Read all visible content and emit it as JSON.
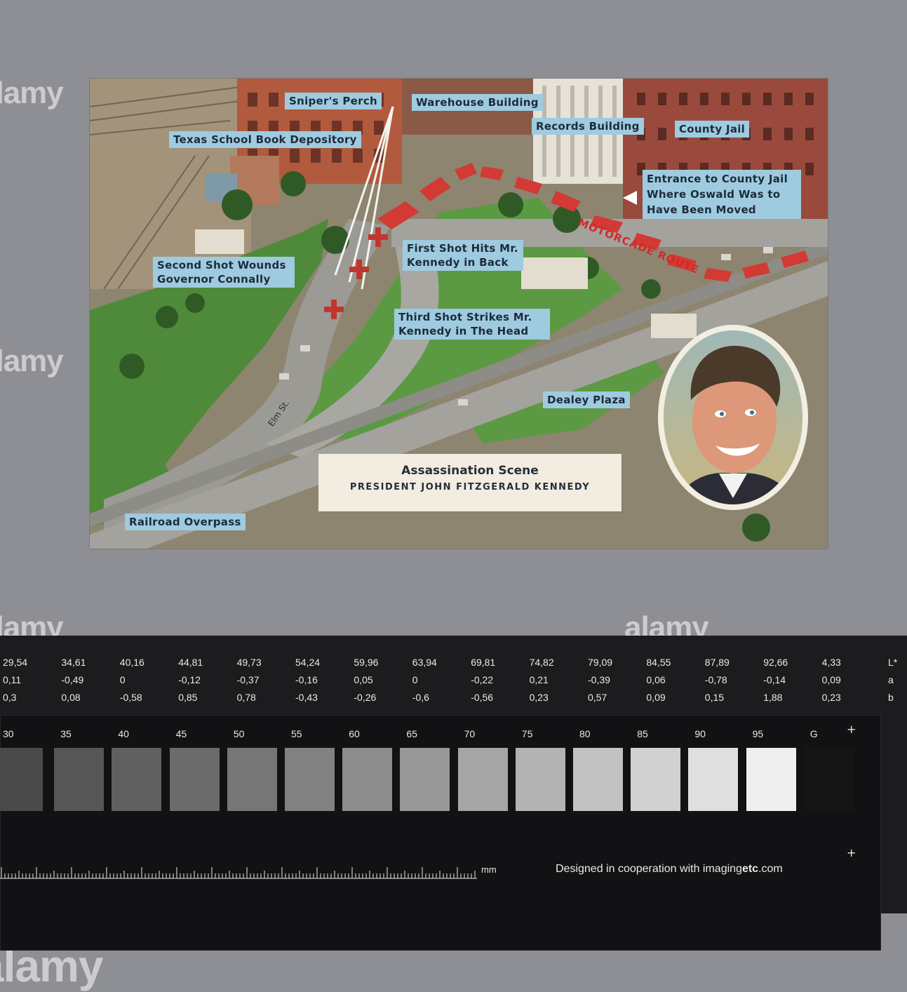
{
  "postcard": {
    "labels": {
      "snipers_perch": "Sniper's Perch",
      "warehouse": "Warehouse Building",
      "records": "Records Building",
      "county_jail": "County Jail",
      "depository": "Texas School Book Depository",
      "entrance": "Entrance to County Jail Where Oswald Was to Have Been Moved",
      "second_shot": "Second Shot Wounds Governor Connally",
      "first_shot": "First Shot Hits Mr. Kennedy in Back",
      "third_shot": "Third Shot Strikes Mr. Kennedy in The Head",
      "dealey": "Dealey Plaza",
      "railroad": "Railroad Overpass",
      "motorcade": "MOTORCADE ROUTE",
      "elm": "Elm St."
    },
    "title": "Assassination Scene",
    "subtitle": "PRESIDENT JOHN FITZGERALD KENNEDY"
  },
  "color_chart": {
    "rows": {
      "L": [
        "29,54",
        "34,61",
        "40,16",
        "44,81",
        "49,73",
        "54,24",
        "59,96",
        "63,94",
        "69,81",
        "74,82",
        "79,09",
        "84,55",
        "87,89",
        "92,66",
        "4,33"
      ],
      "a": [
        "0,11",
        "-0,49",
        "0",
        "-0,12",
        "-0,37",
        "-0,16",
        "0,05",
        "0",
        "-0,22",
        "0,21",
        "-0,39",
        "0,06",
        "-0,78",
        "-0,14",
        "0,09"
      ],
      "b": [
        "0,3",
        "0,08",
        "-0,58",
        "0,85",
        "0,78",
        "-0,43",
        "-0,26",
        "-0,6",
        "-0,56",
        "0,23",
        "0,57",
        "0,09",
        "0,15",
        "1,88",
        "0,23"
      ]
    },
    "row_labels": [
      "L*",
      "a",
      "b"
    ],
    "patch_labels": [
      "30",
      "35",
      "40",
      "45",
      "50",
      "55",
      "60",
      "65",
      "70",
      "75",
      "80",
      "85",
      "90",
      "95",
      "G"
    ],
    "patch_colors": [
      "#4a4a4a",
      "#565656",
      "#606060",
      "#6b6b6b",
      "#767676",
      "#818181",
      "#8d8d8d",
      "#989898",
      "#a5a5a5",
      "#b3b3b3",
      "#c2c2c2",
      "#d1d1d1",
      "#e0e0e0",
      "#efefef",
      "#151515"
    ],
    "ruler_unit": "mm",
    "credit_prefix": "Designed in cooperation with imaging",
    "credit_bold": "etc",
    "credit_suffix": ".com"
  }
}
